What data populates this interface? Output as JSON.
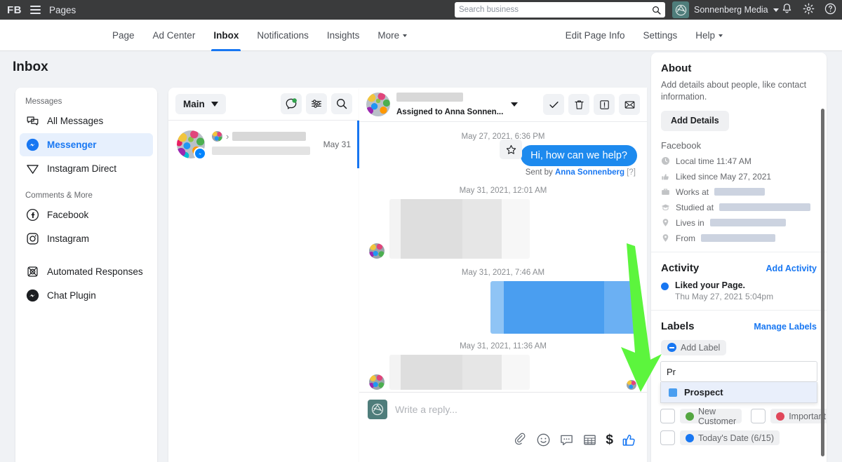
{
  "topbar": {
    "logo": "FB",
    "menu_icon": "hamburger-icon",
    "product": "Pages",
    "search_placeholder": "Search business",
    "search_value": "",
    "account_name": "Sonnenberg Media",
    "icons": [
      "bell-icon",
      "gear-icon",
      "help-icon"
    ]
  },
  "nav": {
    "tabs": [
      {
        "label": "Page",
        "active": false
      },
      {
        "label": "Ad Center",
        "active": false
      },
      {
        "label": "Inbox",
        "active": true
      },
      {
        "label": "Notifications",
        "active": false
      },
      {
        "label": "Insights",
        "active": false
      },
      {
        "label": "More",
        "active": false,
        "caret": true
      }
    ],
    "right": [
      {
        "label": "Edit Page Info"
      },
      {
        "label": "Settings"
      },
      {
        "label": "Help",
        "caret": true
      }
    ]
  },
  "page": {
    "title": "Inbox"
  },
  "sidebar": {
    "group_messages": "Messages",
    "group_comments": "Comments & More",
    "items": [
      {
        "label": "All Messages",
        "icon": "chat-bubbles-icon",
        "selected": false
      },
      {
        "label": "Messenger",
        "icon": "messenger-icon",
        "selected": true
      },
      {
        "label": "Instagram Direct",
        "icon": "paper-plane-icon",
        "selected": false
      },
      {
        "label": "Facebook",
        "icon": "facebook-icon",
        "selected": false
      },
      {
        "label": "Instagram",
        "icon": "instagram-icon",
        "selected": false
      },
      {
        "label": "Automated Responses",
        "icon": "automation-icon",
        "selected": false
      },
      {
        "label": "Chat Plugin",
        "icon": "messenger-icon",
        "selected": false
      }
    ]
  },
  "conversation_list": {
    "folder": "Main",
    "actions": [
      "new-message-icon",
      "filter-icon",
      "search-icon"
    ],
    "rows": [
      {
        "name_redacted": true,
        "preview_redacted": true,
        "date": "May 31",
        "selected": true,
        "channel": "messenger"
      }
    ]
  },
  "thread": {
    "name_redacted": true,
    "assigned_to": "Assigned to Anna Sonnen...",
    "actions": [
      "done-check-icon",
      "trash-icon",
      "flag-icon",
      "mark-unread-icon"
    ],
    "messages": [
      {
        "timestamp": "May 27, 2021, 6:36 PM",
        "direction": "out",
        "text": "Hi, how can we help?",
        "sent_by_prefix": "Sent by",
        "sent_by": "Anna Sonnenberg",
        "sent_by_suffix": "[?]",
        "starred_action": "star-icon"
      },
      {
        "timestamp": "May 31, 2021, 12:01 AM",
        "direction": "in",
        "redacted": true
      },
      {
        "timestamp": "May 31, 2021, 7:46 AM",
        "direction": "out",
        "redacted": true,
        "highlight": "blue"
      },
      {
        "timestamp": "May 31, 2021, 11:36 AM",
        "direction": "in",
        "redacted": true
      }
    ],
    "composer": {
      "placeholder": "Write a reply...",
      "value": "",
      "tools": [
        "attachment-icon",
        "emoji-icon",
        "saved-reply-icon",
        "template-icon",
        "payment-icon",
        "thumbs-up-icon"
      ]
    }
  },
  "details": {
    "about": {
      "title": "About",
      "description": "Add details about people, like contact information.",
      "add_details_button": "Add Details",
      "source_label": "Facebook",
      "rows": [
        {
          "icon": "clock-icon",
          "text": "Local time 11:47 AM",
          "redacted": false
        },
        {
          "icon": "thumbs-up-icon",
          "text": "Liked since May 27, 2021",
          "redacted": false
        },
        {
          "icon": "briefcase-icon",
          "text": "Works at",
          "redacted": true,
          "redact_width": 72
        },
        {
          "icon": "graduation-icon",
          "text": "Studied at",
          "redacted": true,
          "redact_width": 130
        },
        {
          "icon": "pin-icon",
          "text": "Lives in",
          "redacted": true,
          "redact_width": 108
        },
        {
          "icon": "pin-icon",
          "text": "From",
          "redacted": true,
          "redact_width": 106
        }
      ]
    },
    "activity": {
      "title": "Activity",
      "action_link": "Add Activity",
      "entries": [
        {
          "text": "Liked your Page.",
          "time": "Thu May 27, 2021 5:04pm",
          "dot_color": "#1877f2"
        }
      ]
    },
    "labels": {
      "title": "Labels",
      "action_link": "Manage Labels",
      "add_label_chip": "Add Label",
      "search_value": "Pr",
      "dropdown_options": [
        {
          "label": "Prospect",
          "color": "#4a9ef0",
          "highlighted": true
        }
      ],
      "existing": [
        {
          "label": "New Customer",
          "color": "#54a641",
          "checked": false
        },
        {
          "label": "Important",
          "color": "#e0475a",
          "checked": false
        },
        {
          "label": "Today's Date (6/15)",
          "color": "#1877f2",
          "checked": false
        }
      ]
    }
  },
  "annotation": {
    "arrow_color": "#5cf53d",
    "type": "green-arrow-pointing-to-label-search"
  },
  "colors": {
    "topbar_bg": "#3a3b3c",
    "accent_blue": "#1877f2",
    "bubble_blue": "#1d8aee",
    "page_bg": "#f0f2f5",
    "text_primary": "#1c1e21",
    "text_secondary": "#65676b"
  }
}
